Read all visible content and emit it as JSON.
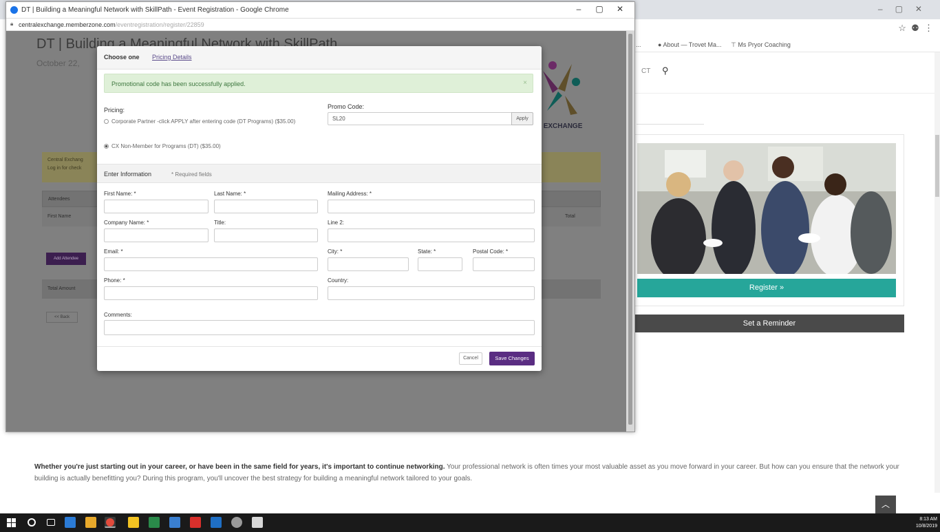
{
  "background": {
    "bookmarks": [
      "...",
      "About — Trovet Ma...",
      "Ms Pryor Coaching"
    ],
    "register_label": "Register »",
    "reminder_label": "Set a Reminder",
    "logo_text": "L EXCHANGE",
    "description_bold": "Whether you're just starting out in your career, or have been in the same field for years, it's important to continue networking.",
    "description_rest": " Your professional network is often times your most valuable asset as you move forward in your career. But how can you ensure that the network your building is actually benefitting you? During this program, you'll uncover the best strategy for building a meaningful network tailored to your goals."
  },
  "popup": {
    "window_title": "DT | Building a Meaningful Network with SkillPath - Event Registration - Google Chrome",
    "url_main": "centralexchange.memberzone.com",
    "url_dim": "/eventregistration/register/22859",
    "underlying": {
      "page_title": "DT | Building a Meaningful Network with SkillPath",
      "date": "October 22,",
      "alert_line1": "Central Exchang",
      "alert_line2": "Log in for check",
      "attendees_header": "Attendees",
      "col_first_name": "First Name",
      "col_total": "Total",
      "add_attendee": "Add Attendee",
      "total_amount": "Total Amount",
      "back_button": "<< Back"
    }
  },
  "modal": {
    "choose_one": "Choose one",
    "pricing_details_link": "Pricing Details",
    "promo_success": "Promotional code has been successfully applied.",
    "pricing_label": "Pricing:",
    "pricing_options": [
      {
        "label": "Corporate Partner -click APPLY after entering code (DT Programs) ($35.00)",
        "selected": false
      },
      {
        "label": "CX Non-Member for Programs (DT) ($35.00)",
        "selected": true
      }
    ],
    "promo_code_label": "Promo Code:",
    "promo_code_value": "SL20",
    "apply_label": "Apply",
    "enter_information": "Enter Information",
    "required_note": "* Required fields",
    "labels": {
      "first_name": "First Name: *",
      "last_name": "Last Name: *",
      "mailing_address": "Mailing Address: *",
      "company_name": "Company Name: *",
      "title": "Title:",
      "line2": "Line 2:",
      "email": "Email: *",
      "city": "City: *",
      "state": "State: *",
      "postal_code": "Postal Code: *",
      "phone": "Phone: *",
      "country": "Country:",
      "comments": "Comments:"
    },
    "cancel_label": "Cancel",
    "save_label": "Save Changes"
  },
  "taskbar": {
    "time": "8:13 AM",
    "date": "10/8/2019"
  }
}
